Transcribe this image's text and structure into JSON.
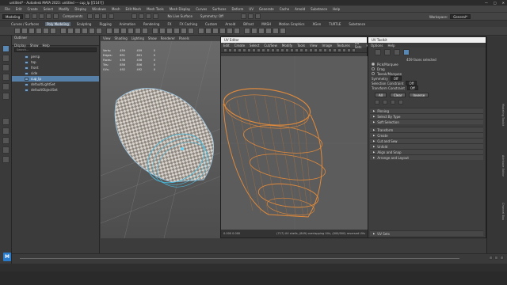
{
  "window": {
    "title": "untitled* - Autodesk MAYA 2023: untitled   ---   cup_lp [[514?]]",
    "minimize": "—",
    "maximize": "□",
    "close": "✕"
  },
  "menubar": [
    "File",
    "Edit",
    "Create",
    "Select",
    "Modify",
    "Display",
    "Windows",
    "Mesh",
    "Edit Mesh",
    "Mesh Tools",
    "Mesh Display",
    "Curves",
    "Surfaces",
    "Deform",
    "UV",
    "Generate",
    "Cache",
    "Arnold",
    "Substance",
    "Help"
  ],
  "statusline": {
    "mode": "Modeling",
    "components": "Components",
    "symmetry": "Symmetry: Off",
    "no_live": "No Live Surface"
  },
  "workspace": {
    "label": "Workspace:",
    "value": "General*"
  },
  "user": "Rachel Kao",
  "shelf_tabs": [
    "Curves / Surfaces",
    "Poly Modeling",
    "Sculpting",
    "Rigging",
    "Animation",
    "Rendering",
    "FX",
    "FX Caching",
    "Custom",
    "Arnold",
    "Bifrost",
    "MASH",
    "Motion Graphics",
    "XGen",
    "TURTLE",
    "Substance"
  ],
  "shelf_active": "Poly Modeling",
  "outliner": {
    "title": "Outliner",
    "menu": [
      "Display",
      "Show",
      "Help"
    ],
    "search_placeholder": "Search...",
    "items": [
      "persp",
      "top",
      "front",
      "side",
      "cup_lp",
      "defaultLightSet",
      "defaultObjectSet"
    ],
    "selected": "cup_lp"
  },
  "viewport": {
    "menu": [
      "View",
      "Shading",
      "Lighting",
      "Show",
      "Renderer",
      "Panels"
    ],
    "camera_label": "persp",
    "hud": [
      {
        "name": "Verts:",
        "a": "459",
        "b": "459",
        "c": "0"
      },
      {
        "name": "Edges:",
        "a": "891",
        "b": "891",
        "c": "0"
      },
      {
        "name": "Faces:",
        "a": "436",
        "b": "436",
        "c": "0"
      },
      {
        "name": "Tris:",
        "a": "856",
        "b": "856",
        "c": "0"
      },
      {
        "name": "UVs:",
        "a": "492",
        "b": "492",
        "c": "0"
      }
    ]
  },
  "uv_editor": {
    "title": "UV Editor",
    "menu": [
      "Edit",
      "Create",
      "Select",
      "Cut/Sew",
      "Modify",
      "Tools",
      "View",
      "Image",
      "Textures",
      "UV Sets",
      "Help"
    ],
    "status_left": "0.000  0.000",
    "status_right": "(717) UV shells, (849) overlapping UVs, (000/000) reversed UVs"
  },
  "uv_toolkit": {
    "title": "UV Toolkit",
    "menu": [
      "Options",
      "Help"
    ],
    "count": "459 faces selected",
    "pick_modes": [
      "Pick/Marquee",
      "Drag",
      "Tweak/Marquee"
    ],
    "symmetry_label": "Symmetry",
    "symmetry_value": "Off",
    "sel_constraint": "Selection Constraint",
    "sel_value": "Off",
    "xform_constraint": "Transform Constraint",
    "xform_value": "Off",
    "buttons": [
      "All",
      "Clear",
      "Inverse"
    ],
    "sections": [
      "Pinning",
      "Select By Type",
      "Soft Selection",
      "Transform",
      "Create",
      "Cut and Sew",
      "Unfold",
      "Align and Snap",
      "Arrange and Layout"
    ],
    "footer": "UV Sets"
  },
  "right_tabs": [
    "Modeling Toolkit",
    "Attribute Editor",
    "Channel Box"
  ],
  "logo": "M"
}
